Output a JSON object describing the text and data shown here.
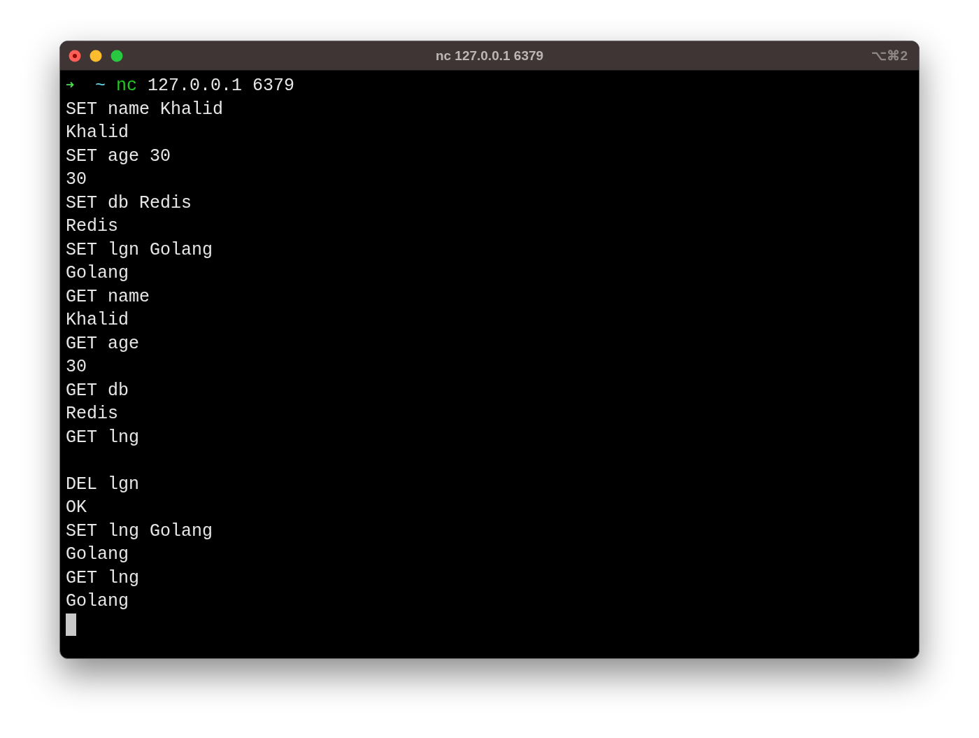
{
  "window": {
    "title": "nc 127.0.0.1 6379",
    "shortcut": "⌥⌘2"
  },
  "terminal": {
    "prompt": {
      "arrow": "➜",
      "directory": "~",
      "command": "nc",
      "arguments": "127.0.0.1 6379"
    },
    "lines": [
      {
        "kind": "text",
        "text": "SET name Khalid"
      },
      {
        "kind": "text",
        "text": "Khalid"
      },
      {
        "kind": "text",
        "text": "SET age 30"
      },
      {
        "kind": "text",
        "text": "30"
      },
      {
        "kind": "text",
        "text": "SET db Redis"
      },
      {
        "kind": "text",
        "text": "Redis"
      },
      {
        "kind": "text",
        "text": "SET lgn Golang"
      },
      {
        "kind": "text",
        "text": "Golang"
      },
      {
        "kind": "text",
        "text": "GET name"
      },
      {
        "kind": "text",
        "text": "Khalid"
      },
      {
        "kind": "text",
        "text": "GET age"
      },
      {
        "kind": "text",
        "text": "30"
      },
      {
        "kind": "text",
        "text": "GET db"
      },
      {
        "kind": "text",
        "text": "Redis"
      },
      {
        "kind": "text",
        "text": "GET lng"
      },
      {
        "kind": "blank"
      },
      {
        "kind": "text",
        "text": "DEL lgn"
      },
      {
        "kind": "text",
        "text": "OK"
      },
      {
        "kind": "text",
        "text": "SET lng Golang"
      },
      {
        "kind": "text",
        "text": "Golang"
      },
      {
        "kind": "text",
        "text": "GET lng"
      },
      {
        "kind": "text",
        "text": "Golang"
      }
    ],
    "cursor_visible": true
  }
}
